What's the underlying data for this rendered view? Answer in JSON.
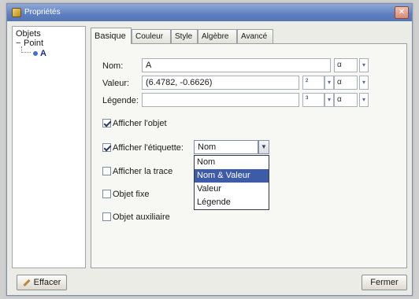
{
  "window": {
    "title": "Propriétés"
  },
  "tree": {
    "root": "Objets",
    "category_toggle": "−",
    "category": "Point",
    "item": "A"
  },
  "tabs": [
    {
      "label": "Basique",
      "active": true
    },
    {
      "label": "Couleur",
      "active": false
    },
    {
      "label": "Style",
      "active": false
    },
    {
      "label": "Algèbre",
      "active": false
    },
    {
      "label": "Avancé",
      "active": false
    }
  ],
  "basic": {
    "name_label": "Nom:",
    "name_value": "A",
    "value_label": "Valeur:",
    "value_value": "(6.4782, -0.6626)",
    "caption_label": "Légende:",
    "caption_value": "",
    "alpha_symbol": "α",
    "sup_symbol": "²",
    "sup_symbol2": "³",
    "show_object": {
      "label": "Afficher l'objet",
      "checked": true
    },
    "show_label": {
      "label": "Afficher l'étiquette:",
      "checked": true,
      "selected": "Nom"
    },
    "show_trace": {
      "label": "Afficher la trace",
      "checked": false
    },
    "fix_object": {
      "label": "Objet fixe",
      "checked": false
    },
    "aux_object": {
      "label": "Objet auxiliaire",
      "checked": false
    },
    "label_options": [
      "Nom",
      "Nom & Valeur",
      "Valeur",
      "Légende"
    ],
    "highlighted_option": "Nom & Valeur"
  },
  "buttons": {
    "delete": "Effacer",
    "close": "Fermer"
  }
}
